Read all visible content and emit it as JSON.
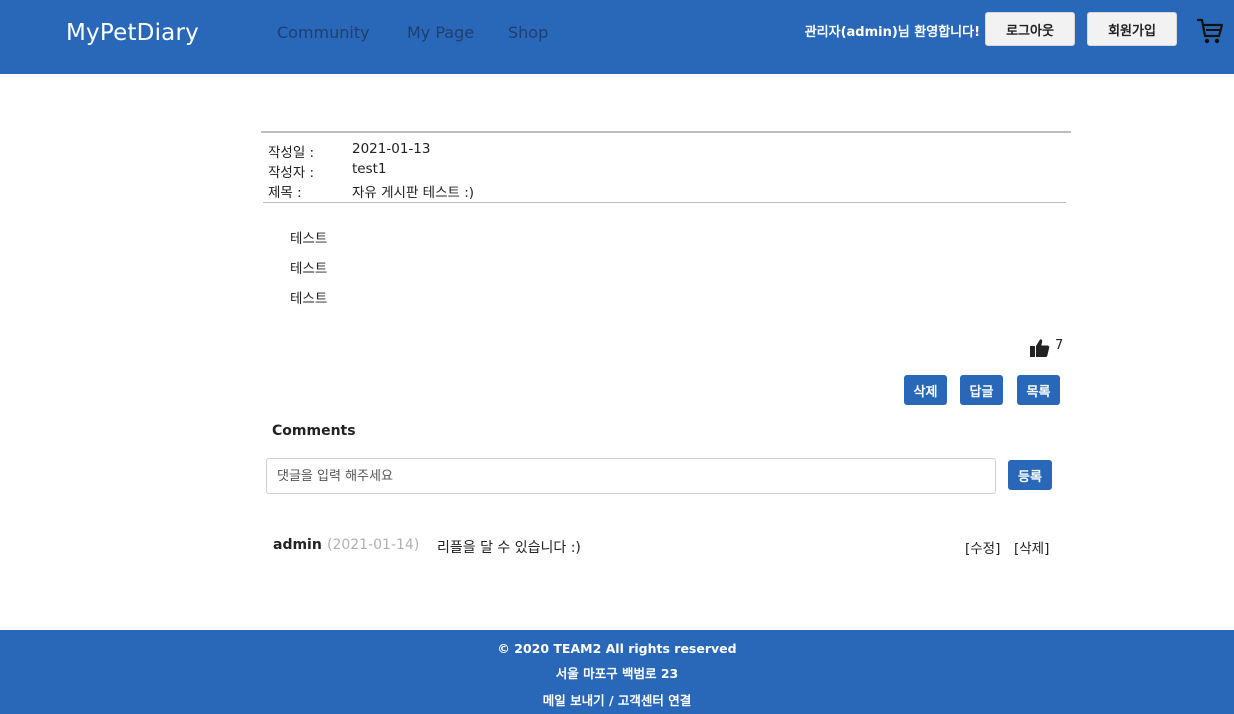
{
  "header": {
    "logo": "MyPetDiary",
    "nav": [
      "Community",
      "My Page",
      "Shop"
    ],
    "welcome": "관리자(admin)님 환영합니다!",
    "logout_label": "로그아웃",
    "signup_label": "회원가입",
    "cart_icon": "cart-icon"
  },
  "post": {
    "date_label": "작성일 :",
    "date_value": "2021-01-13",
    "author_label": "작성자 :",
    "author_value": "test1",
    "title_label": "제목 :",
    "title_value": "자유 게시판 테스트 :)",
    "body_lines": [
      "테스트",
      "테스트",
      "테스트"
    ],
    "like_icon": "thumbs-up-icon",
    "likes": "7"
  },
  "actions": {
    "delete_label": "삭제",
    "reply_label": "답글",
    "list_label": "목록"
  },
  "comments": {
    "title": "Comments",
    "placeholder": "댓글을 입력 해주세요",
    "submit_label": "등록",
    "items": [
      {
        "author": "admin",
        "date": "(2021-01-14)",
        "text": "리플을 달 수 있습니다 :)",
        "edit_label": "[수정]",
        "delete_label": "[삭제]"
      }
    ]
  },
  "footer": {
    "copyright": "© 2020 TEAM2 All rights reserved",
    "address": "서울 마포구 백범로 23",
    "links": "메일 보내기 / 고객센터 연결"
  },
  "colors": {
    "brand": "#2968b8",
    "nav_text": "#1f3f70"
  }
}
